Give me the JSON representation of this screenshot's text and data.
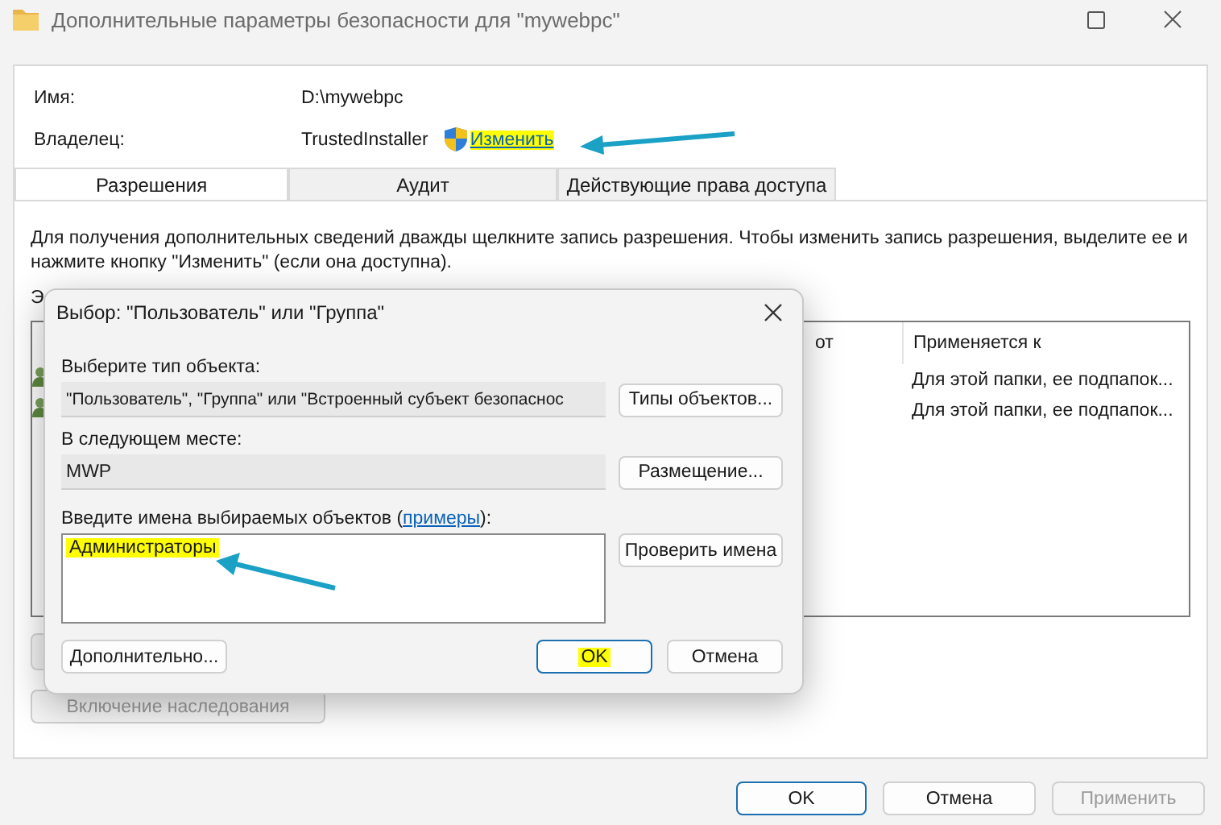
{
  "window": {
    "title": "Дополнительные параметры безопасности  для \"mywebpc\""
  },
  "properties": [
    {
      "label": "Имя:",
      "value": "D:\\mywebpc"
    },
    {
      "label": "Владелец:",
      "value": "TrustedInstaller"
    }
  ],
  "owner_link": {
    "text": "Изменить",
    "highlighted": true
  },
  "tabs": [
    {
      "label": "Разрешения",
      "selected": true
    },
    {
      "label": "Аудит",
      "selected": false
    },
    {
      "label": "Действующие права доступа",
      "selected": false
    }
  ],
  "description": "Для получения дополнительных сведений дважды щелкните запись разрешения. Чтобы изменить запись разрешения, выделите ее и нажмите кнопку \"Изменить\" (если она доступна).",
  "cut_label": "Э",
  "table": {
    "columns": [
      {
        "label": "от"
      },
      {
        "label": "Применяется к"
      }
    ],
    "rows": [
      {
        "applies_to": "Для этой папки, ее подпапок..."
      },
      {
        "applies_to": "Для этой папки, ее подпапок..."
      }
    ]
  },
  "inheritance_button": {
    "label": "Включение наследования",
    "disabled": true
  },
  "footer_buttons": [
    {
      "label": "OK",
      "disabled": false,
      "default": true
    },
    {
      "label": "Отмена",
      "disabled": false,
      "default": false
    },
    {
      "label": "Применить",
      "disabled": true,
      "default": false
    }
  ],
  "dialog": {
    "title": "Выбор: \"Пользователь\" или \"Группа\"",
    "object_type": {
      "label": "Выберите тип объекта:",
      "value": "\"Пользователь\", \"Группа\" или \"Встроенный субъект безопаснос",
      "button": "Типы объектов..."
    },
    "location": {
      "label": "В следующем месте:",
      "value": "MWP",
      "button": "Размещение..."
    },
    "names": {
      "label_start": "Введите имена выбираемых объектов (",
      "link": "примеры",
      "label_end": "):",
      "value": "Администраторы",
      "highlighted": true,
      "button": "Проверить имена"
    },
    "buttons": [
      {
        "label": "Дополнительно...",
        "default": false,
        "highlighted": false
      },
      {
        "label": "OK",
        "default": true,
        "highlighted": true
      },
      {
        "label": "Отмена",
        "default": false,
        "highlighted": false
      }
    ]
  }
}
